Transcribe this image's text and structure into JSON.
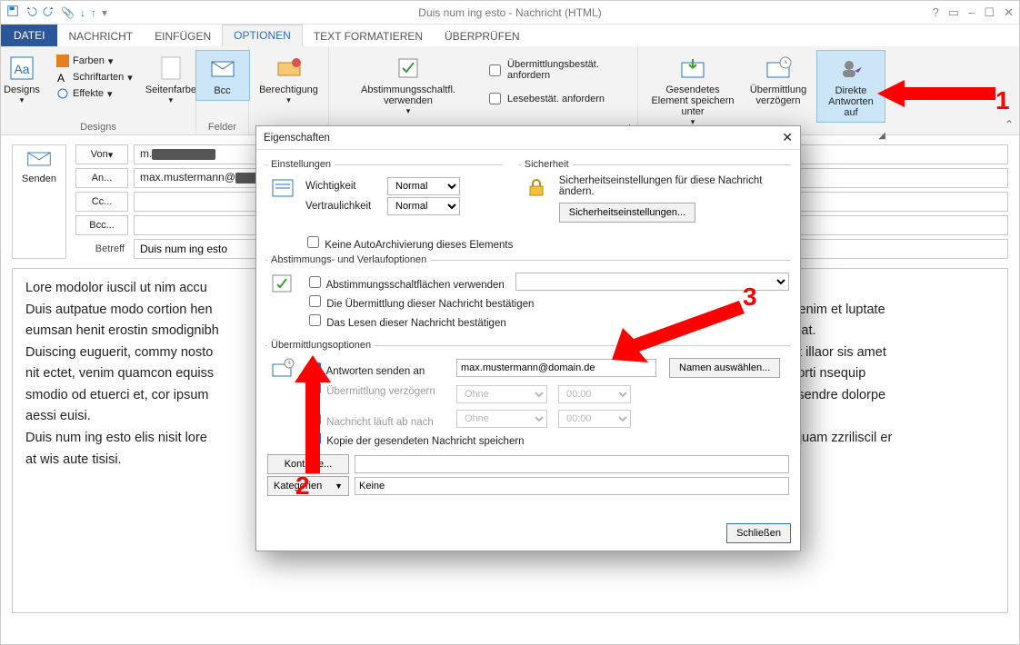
{
  "window": {
    "title": "Duis num ing esto - Nachricht (HTML)"
  },
  "tabs": {
    "file": "DATEI",
    "message": "NACHRICHT",
    "insert": "EINFÜGEN",
    "options": "OPTIONEN",
    "format": "TEXT FORMATIEREN",
    "review": "ÜBERPRÜFEN"
  },
  "ribbon": {
    "designs_group": "Designs",
    "designs_btn": "Designs",
    "colors": "Farben",
    "fonts": "Schriftarten",
    "effects": "Effekte",
    "pagecolor": "Seitenfarbe",
    "showfields_group": "Felder",
    "bcc": "Bcc",
    "permission": "Berechtigung",
    "voting": "Abstimmungsschaltfl. verwenden",
    "delivery_receipt": "Übermittlungsbestät. anfordern",
    "read_receipt": "Lesebestät. anfordern",
    "save_sent": "Gesendetes Element speichern unter",
    "delay": "Übermittlung verzögern",
    "direct_replies": "Direkte Antworten auf",
    "more_options_group": ""
  },
  "compose": {
    "send": "Senden",
    "from": "Von",
    "from_value": "m.",
    "to": "An...",
    "to_value": "max.mustermann@",
    "cc": "Cc...",
    "bcc": "Bcc...",
    "subject_label": "Betreff",
    "subject_value": "Duis num ing esto"
  },
  "body": {
    "p1": "Lore modolor iuscil ut nim accu",
    "p2": "Duis autpatue modo cortion hen",
    "p3": "eumsan henit erostin smodignibh",
    "p4": "Duiscing euguerit, commy nosto",
    "p5": "nit ectet, venim quamcon equiss",
    "p6": "smodio od etuerci et, cor ipsum",
    "p7": "aessi euisi.",
    "p8": "Duis num ing esto elis nisit lore",
    "p9": "at wis aute tisisi.",
    "r2": "nstrud tionsenim et luptate",
    "r3": "lorpera sequat.",
    "r4": "um ip et, quat illaor sis amet",
    "r5": "onsent el dolorti nsequip",
    "r6": "e eros do consendre dolorpe",
    "r8": "ero del ut veliquam zzriliscil er"
  },
  "dialog": {
    "title": "Eigenschaften",
    "settings_legend": "Einstellungen",
    "importance": "Wichtigkeit",
    "importance_value": "Normal",
    "sensitivity": "Vertraulichkeit",
    "sensitivity_value": "Normal",
    "no_autoarchive": "Keine AutoArchivierung dieses Elements",
    "security_legend": "Sicherheit",
    "security_desc": "Sicherheitseinstellungen für diese Nachricht ändern.",
    "security_btn": "Sicherheitseinstellungen...",
    "voting_legend": "Abstimmungs- und Verlaufoptionen",
    "voting_cb": "Abstimmungsschaltflächen verwenden",
    "delivery_cb": "Die Übermittlung dieser Nachricht bestätigen",
    "read_cb": "Das Lesen dieser Nachricht bestätigen",
    "delivery_legend": "Übermittlungsoptionen",
    "reply_to_cb": "Antworten senden an",
    "reply_to_value": "max.mustermann@domain.de",
    "select_names": "Namen auswählen...",
    "delay_cb": "Übermittlung verzögern bis",
    "delay_date": "Ohne",
    "delay_time": "00:00",
    "expire_cb": "Nachricht läuft ab nach",
    "expire_date": "Ohne",
    "expire_time": "00:00",
    "save_copy_cb": "Kopie der gesendeten Nachricht speichern",
    "contacts_btn": "Kontakte...",
    "categories_btn": "Kategorien",
    "categories_value": "Keine",
    "close": "Schließen"
  },
  "annotations": {
    "one": "1",
    "two": "2",
    "three": "3"
  }
}
